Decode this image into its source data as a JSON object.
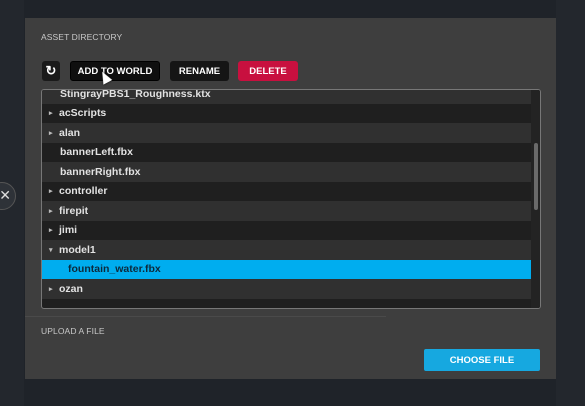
{
  "asset_directory": {
    "title": "ASSET DIRECTORY",
    "toolbar": {
      "refresh_icon": "refresh-icon",
      "add_to_world_label": "ADD TO WORLD",
      "rename_label": "RENAME",
      "delete_label": "DELETE"
    },
    "items": [
      {
        "label": "StingrayPBS1_Roughness.ktx",
        "type": "file",
        "expanded": false
      },
      {
        "label": "acScripts",
        "type": "folder",
        "expanded": false
      },
      {
        "label": "alan",
        "type": "folder",
        "expanded": false
      },
      {
        "label": "bannerLeft.fbx",
        "type": "file",
        "expanded": false
      },
      {
        "label": "bannerRight.fbx",
        "type": "file",
        "expanded": false
      },
      {
        "label": "controller",
        "type": "folder",
        "expanded": false
      },
      {
        "label": "firepit",
        "type": "folder",
        "expanded": false
      },
      {
        "label": "jimi",
        "type": "folder",
        "expanded": false
      },
      {
        "label": "model1",
        "type": "folder",
        "expanded": true
      },
      {
        "label": "fountain_water.fbx",
        "type": "file",
        "selected": true
      },
      {
        "label": "ozan",
        "type": "folder",
        "expanded": false
      }
    ],
    "selected_item": "fountain_water.fbx"
  },
  "upload": {
    "title": "UPLOAD A FILE",
    "choose_file_label": "CHOOSE FILE"
  },
  "colors": {
    "delete": "#c8103f",
    "selection": "#00adef",
    "choose_file": "#16a8e0"
  }
}
